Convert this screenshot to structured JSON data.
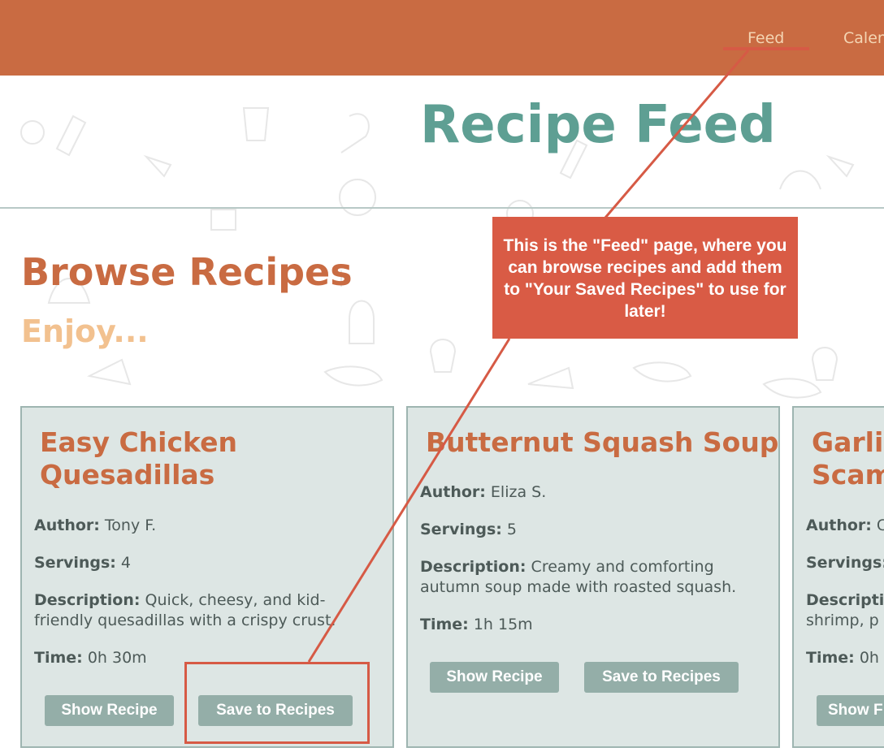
{
  "nav": {
    "items": [
      "Feed",
      "Calen"
    ]
  },
  "header": {
    "title": "Recipe Feed"
  },
  "section": {
    "title": "Browse Recipes",
    "subtitle": "Enjoy..."
  },
  "labels": {
    "author": "Author:",
    "servings": "Servings:",
    "description": "Description:",
    "time": "Time:",
    "show": "Show Recipe",
    "save": "Save to Recipes"
  },
  "cards": [
    {
      "title_lines": [
        "Easy Chicken",
        "Quesadillas"
      ],
      "author": "Tony F.",
      "servings": "4",
      "description": "Quick, cheesy, and kid-friendly quesadillas with a crispy crust.",
      "time": "0h 30m"
    },
    {
      "title_lines": [
        "Butternut Squash Soup"
      ],
      "author": "Eliza S.",
      "servings": "5",
      "description": "Creamy and comforting autumn soup made with roasted squash.",
      "time": "1h 15m"
    },
    {
      "title_lines": [
        "Garlic",
        "Scam"
      ],
      "author": "C",
      "servings": "",
      "description_label": "Descripti",
      "description": "shrimp, p",
      "time": "0h",
      "show_label": "Show F"
    }
  ],
  "annotation": {
    "callout": "This is the \"Feed\" page, where you can browse recipes and add them to \"Your Saved Recipes\" to use for later!"
  },
  "colors": {
    "navbar": "#c96b42",
    "nav_text": "#f4d5b3",
    "title": "#5e9f93",
    "heading": "#c96b42",
    "subheading": "#f2c18f",
    "card_bg": "#dde6e4",
    "card_border": "#9eb5b1",
    "button": "#94aea8",
    "annotation": "#d95b45"
  }
}
